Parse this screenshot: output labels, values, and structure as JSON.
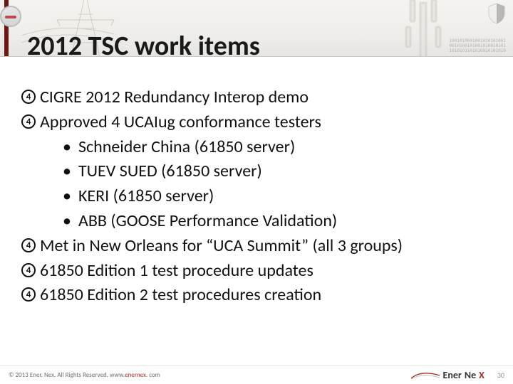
{
  "title": "2012 TSC work items",
  "bullets": [
    {
      "num": "4",
      "text": "CIGRE 2012 Redundancy Interop demo"
    },
    {
      "num": "4",
      "text": "Approved 4 UCAIug conformance testers"
    },
    {
      "num": "4",
      "text": "Met in New Orleans for “UCA Summit” (all 3 groups)"
    },
    {
      "num": "4",
      "text": "61850 Edition 1 test procedure updates"
    },
    {
      "num": "4",
      "text": "61850 Edition 2 test procedures creation"
    }
  ],
  "sub_bullets": [
    "Schneider China (61850 server)",
    "TUEV SUED (61850 server)",
    "KERI (61850 server)",
    "ABB (GOOSE Performance Validation)"
  ],
  "footer": {
    "copyright_prefix": "© 2013 Ener. Nex. All Rights Reserved. www.",
    "site": "enernex",
    "copyright_suffix": ". com",
    "page": "30",
    "brand_a": "Ener",
    "brand_b": "Ne"
  },
  "code_lines": [
    "1001010001001010101001",
    "0010100101001010010101",
    "1010101101010010101010"
  ]
}
